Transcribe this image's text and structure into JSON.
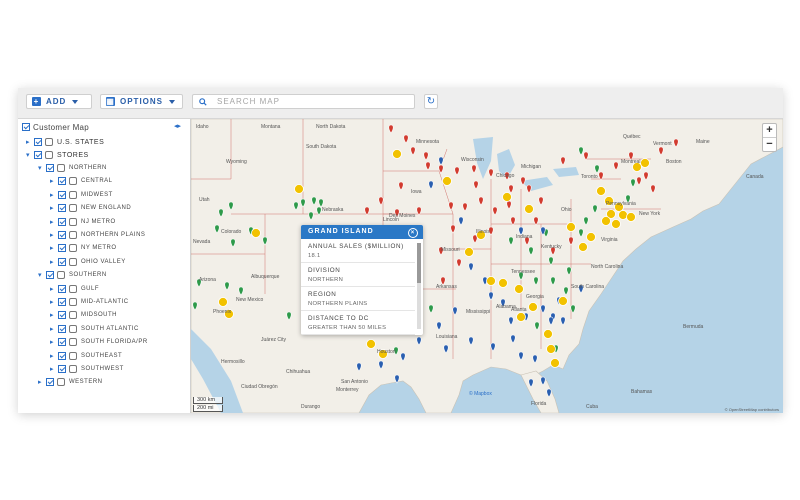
{
  "toolbar": {
    "add_label": "ADD",
    "options_label": "OPTIONS",
    "search_placeholder": "SEARCH MAP"
  },
  "sidebar": {
    "root_label": "Customer Map",
    "layers": [
      {
        "label": "U.S. STATES"
      },
      {
        "label": "STORES"
      }
    ],
    "groups": [
      {
        "label": "NORTHERN",
        "children": [
          "CENTRAL",
          "MIDWEST",
          "NEW ENGLAND",
          "NJ METRO",
          "NORTHERN PLAINS",
          "NY METRO",
          "OHIO VALLEY"
        ]
      },
      {
        "label": "SOUTHERN",
        "children": [
          "GULF",
          "MID-ATLANTIC",
          "MIDSOUTH",
          "SOUTH ATLANTIC",
          "SOUTH FLORIDA/PR",
          "SOUTHEAST",
          "SOUTHWEST"
        ]
      },
      {
        "label": "WESTERN",
        "children": []
      }
    ]
  },
  "popup": {
    "title": "GRAND ISLAND",
    "fields": [
      {
        "label": "ANNUAL SALES ($MILLION)",
        "value": "18.1"
      },
      {
        "label": "DIVISION",
        "value": "NORTHERN"
      },
      {
        "label": "REGION",
        "value": "NORTHERN PLAINS"
      },
      {
        "label": "DISTANCE TO DC",
        "value": "GREATER THAN 50 MILES"
      }
    ]
  },
  "map": {
    "zoom_in": "+",
    "zoom_out": "−",
    "scale_km": "300 km",
    "scale_mi": "200 mi",
    "labels": [
      "Nebraska",
      "Des Moines",
      "Chicago",
      "Ohio",
      "Kansas",
      "Oklahoma",
      "Texas",
      "Albuquerque",
      "Phoenix",
      "Dallas",
      "Houston",
      "San Antonio",
      "Monterrey",
      "Hermosillo",
      "Ciudad Obregón",
      "Juárez City",
      "Florida",
      "Atlanta",
      "Québec",
      "Montreal",
      "Toronto",
      "Boston",
      "Bermuda",
      "Canada",
      "New York",
      "Vermont",
      "Maine",
      "Colorado",
      "Lincoln",
      "Minnesota",
      "Wisconsin",
      "Michigan",
      "Indiana",
      "Kentucky",
      "Tennessee",
      "Mississippi",
      "Alabama",
      "Georgia",
      "South Carolina",
      "North Carolina",
      "Virginia",
      "Pennsylvania",
      "Arkansas",
      "Louisiana",
      "Missouri",
      "Iowa",
      "Illinois",
      "Wyoming",
      "Montana",
      "South Dakota",
      "North Dakota",
      "Utah",
      "New Mexico",
      "Arizona",
      "Nevada",
      "Idaho",
      "Cuba",
      "Bahamas",
      "Havana",
      "Chihuahua",
      "Durango"
    ],
    "attribution": "© OpenStreetMap contributors",
    "watermark": "© Mapbox",
    "colors": {
      "water": "#b5d3e7",
      "land": "#f2efe8",
      "red": "#d23b2f",
      "green": "#2e9a4a",
      "blue": "#2a5fb0",
      "cluster": "#f2c200"
    }
  }
}
